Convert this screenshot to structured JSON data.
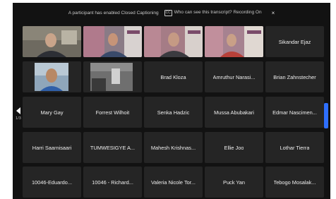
{
  "notice": {
    "text": "A participant has enabled Closed Captioning",
    "cc_badge": "CC",
    "link_text": "Who can see this transcript? Recording On",
    "close": "×"
  },
  "pagination": {
    "current": "1/3"
  },
  "participants": [
    {
      "name": "",
      "video": true
    },
    {
      "name": "",
      "video": true
    },
    {
      "name": "",
      "video": true
    },
    {
      "name": "",
      "video": true
    },
    {
      "name": "Sikandar Ejaz",
      "video": false
    },
    {
      "name": "",
      "video": true
    },
    {
      "name": "",
      "video": true
    },
    {
      "name": "Brad Kloza",
      "video": false
    },
    {
      "name": "Amruthur Narasi...",
      "video": false
    },
    {
      "name": "Brian Zahnstecher",
      "video": false
    },
    {
      "name": "Mary Gay",
      "video": false
    },
    {
      "name": "Forrest Wilhoit",
      "video": false
    },
    {
      "name": "Senka Hadzic",
      "video": false
    },
    {
      "name": "Mussa Abubakari",
      "video": false
    },
    {
      "name": "Edmar Nascimen...",
      "video": false
    },
    {
      "name": "Harri Saarnisaari",
      "video": false
    },
    {
      "name": "TUMWESIGYE A...",
      "video": false
    },
    {
      "name": "Mahesh Krishnas...",
      "video": false
    },
    {
      "name": "Ellie Joo",
      "video": false
    },
    {
      "name": "Lothar Tierra",
      "video": false
    },
    {
      "name": "10046-Eduardo...",
      "video": false
    },
    {
      "name": "10046 - Richard...",
      "video": false
    },
    {
      "name": "Valeria Nicole Tor...",
      "video": false
    },
    {
      "name": "Puck Yan",
      "video": false
    },
    {
      "name": "Tebogo Mosalak...",
      "video": false
    }
  ]
}
